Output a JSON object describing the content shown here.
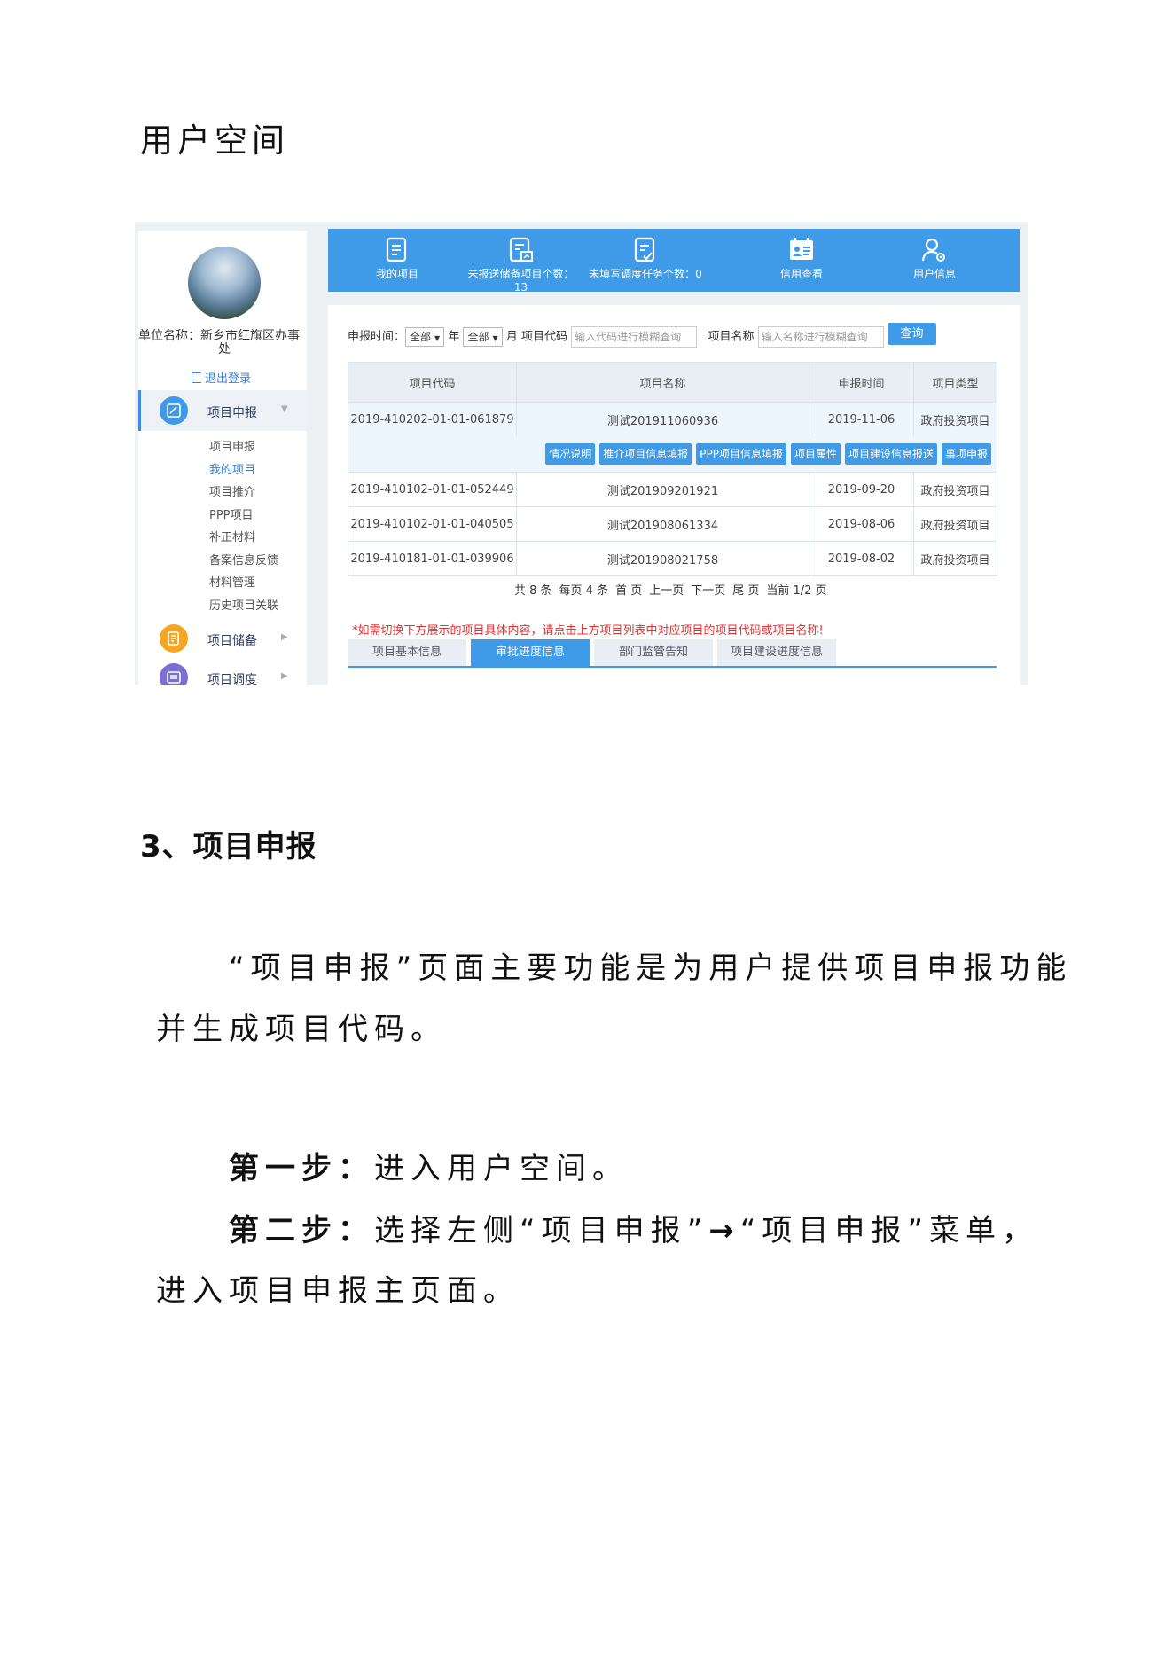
{
  "doc": {
    "heading": "用户空间",
    "section_title": "3、项目申报",
    "para1_line1": "“项目申报”页面主要功能是为用户提供项目申报功能",
    "para1_line2": "并生成项目代码。",
    "step1_label": "第一步：",
    "step1_text": "进入用户空间。",
    "step2_label": "第二步：",
    "step2_text_a": "选择左侧“项目申报”",
    "step2_arrow": "→",
    "step2_text_b": "“项目申报”菜单，",
    "step2_line2": "进入项目申报主页面。"
  },
  "sidebar": {
    "unit_label": "单位名称：新乡市红旗区办事",
    "unit_label_cont": "处",
    "logout": "退出登录",
    "menus": [
      {
        "label": "项目申报",
        "color": "#3f9ae8",
        "icon": "edit-icon"
      },
      {
        "label": "项目储备",
        "color": "#f5a623",
        "icon": "storage-icon"
      },
      {
        "label": "项目调度",
        "color": "#7b6fd6",
        "icon": "schedule-icon"
      }
    ],
    "submenu": [
      "项目申报",
      "我的项目",
      "项目推介",
      "PPP项目",
      "补正材料",
      "备案信息反馈",
      "材料管理",
      "历史项目关联"
    ]
  },
  "topnav": [
    {
      "label": "我的项目",
      "icon": "doc-icon"
    },
    {
      "label": "未报送储备项目个数：13",
      "icon": "doc-chart-icon"
    },
    {
      "label": "未填写调度任务个数：0",
      "icon": "doc-check-icon"
    },
    {
      "label": "信用查看",
      "icon": "credit-card-icon"
    },
    {
      "label": "用户信息",
      "icon": "user-gear-icon"
    }
  ],
  "filter": {
    "time_label": "申报时间：",
    "year_value": "全部",
    "year_unit": "年",
    "month_value": "全部",
    "month_unit": "月",
    "code_label": "项目代码",
    "code_placeholder": "输入代码进行模糊查询",
    "name_label": "项目名称",
    "name_placeholder": "输入名称进行模糊查询",
    "query_button": "查询"
  },
  "table": {
    "headers": [
      "项目代码",
      "项目名称",
      "申报时间",
      "项目类型"
    ],
    "rows": [
      [
        "2019-410202-01-01-061879",
        "测试201911060936",
        "2019-11-06",
        "政府投资项目"
      ],
      [
        "2019-410102-01-01-052449",
        "测试201909201921",
        "2019-09-20",
        "政府投资项目"
      ],
      [
        "2019-410102-01-01-040505",
        "测试201908061334",
        "2019-08-06",
        "政府投资项目"
      ],
      [
        "2019-410181-01-01-039906",
        "测试201908021758",
        "2019-08-02",
        "政府投资项目"
      ]
    ],
    "actions": [
      "情况说明",
      "推介项目信息填报",
      "PPP项目信息填报",
      "项目属性",
      "项目建设信息报送",
      "事项申报"
    ]
  },
  "pager": {
    "total": "共 8 条",
    "per_page": "每页 4 条",
    "first": "首 页",
    "prev": "上一页",
    "next": "下一页",
    "last": "尾 页",
    "current": "当前 1/2 页"
  },
  "notice": "*如需切换下方展示的项目具体内容，请点击上方项目列表中对应项目的项目代码或项目名称!",
  "tabs": [
    "项目基本信息",
    "审批进度信息",
    "部门监管告知",
    "项目建设进度信息"
  ],
  "colors": {
    "nav_blue": "#3f9ae8",
    "notice_red": "#e23131"
  }
}
